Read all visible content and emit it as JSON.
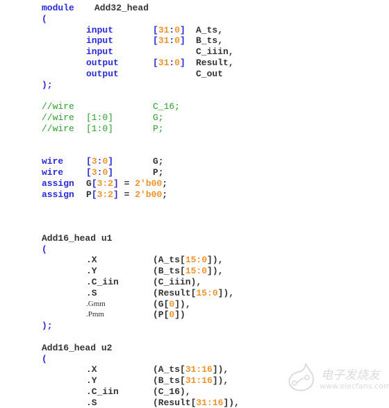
{
  "lines": [
    {
      "type": "module",
      "kw": "module",
      "name": "Add32_head"
    },
    {
      "type": "paren",
      "text": "("
    },
    {
      "type": "port",
      "kw": "input",
      "range_l": "[",
      "range_n": "31",
      "range_c": ":",
      "range_m": "0",
      "range_r": "]",
      "name": "A_ts,"
    },
    {
      "type": "port",
      "kw": "input",
      "range_l": "[",
      "range_n": "31",
      "range_c": ":",
      "range_m": "0",
      "range_r": "]",
      "name": "B_ts,"
    },
    {
      "type": "port",
      "kw": "input",
      "name": "C_iiin,"
    },
    {
      "type": "port",
      "kw": "output",
      "range_l": "[",
      "range_n": "31",
      "range_c": ":",
      "range_m": "0",
      "range_r": "]",
      "name": "Result,"
    },
    {
      "type": "port",
      "kw": "output",
      "name": "C_out"
    },
    {
      "type": "paren",
      "text": ");"
    },
    {
      "type": "blank"
    },
    {
      "type": "comment",
      "c1": "//wire",
      "c2": "",
      "c3": "C_16;"
    },
    {
      "type": "comment",
      "c1": "//wire",
      "c2": "[1:0]",
      "c3": "G;"
    },
    {
      "type": "comment",
      "c1": "//wire",
      "c2": "[1:0]",
      "c3": "P;"
    },
    {
      "type": "blank"
    },
    {
      "type": "blank"
    },
    {
      "type": "wire",
      "kw": "wire",
      "range_l": "[",
      "range_n": "3",
      "range_c": ":",
      "range_m": "0",
      "range_r": "]",
      "name": "G;"
    },
    {
      "type": "wire",
      "kw": "wire",
      "range_l": "[",
      "range_n": "3",
      "range_c": ":",
      "range_m": "0",
      "range_r": "]",
      "name": "P;"
    },
    {
      "type": "assign",
      "kw": "assign",
      "lhs": "G",
      "idx_l": "[",
      "idx": "3:2",
      "idx_r": "]",
      "eq": " = ",
      "val": "2'b00",
      "end": ";"
    },
    {
      "type": "assign",
      "kw": "assign",
      "lhs": "P",
      "idx_l": "[",
      "idx": "3:2",
      "idx_r": "]",
      "eq": " = ",
      "val": "2'b00",
      "end": ";"
    },
    {
      "type": "blank"
    },
    {
      "type": "blank"
    },
    {
      "type": "blank"
    },
    {
      "type": "inst",
      "text": "Add16_head u1"
    },
    {
      "type": "paren",
      "text": "("
    },
    {
      "type": "conn",
      "port": ".X",
      "pre": "(A_ts[",
      "num": "15:0",
      "post": "]),"
    },
    {
      "type": "conn",
      "port": ".Y",
      "pre": "(B_ts[",
      "num": "15:0",
      "post": "]),"
    },
    {
      "type": "conn",
      "port": ".C_iin",
      "pre": "(C_iiin),",
      "num": "",
      "post": ""
    },
    {
      "type": "conn",
      "port": ".S",
      "pre": "(Result[",
      "num": "15:0",
      "post": "]),"
    },
    {
      "type": "conn",
      "port": ".Gmm",
      "small": true,
      "pre": "(G[",
      "num": "0",
      "post": "]),"
    },
    {
      "type": "conn",
      "port": ".Pmm",
      "small": true,
      "pre": "(P[",
      "num": "0",
      "post": "])"
    },
    {
      "type": "paren",
      "text": ");"
    },
    {
      "type": "blank"
    },
    {
      "type": "inst",
      "text": "Add16_head u2"
    },
    {
      "type": "paren",
      "text": "("
    },
    {
      "type": "conn",
      "port": ".X",
      "pre": "(A_ts[",
      "num": "31:16",
      "post": "]),"
    },
    {
      "type": "conn",
      "port": ".Y",
      "pre": "(B_ts[",
      "num": "31:16",
      "post": "]),"
    },
    {
      "type": "conn",
      "port": ".C_iin",
      "pre": "(C_16),",
      "num": "",
      "post": ""
    },
    {
      "type": "conn",
      "port": ".S",
      "pre": "(Result[",
      "num": "31:16",
      "post": "]),"
    }
  ],
  "watermark": {
    "icon": "elecfans-logo-icon",
    "title": "电子发烧友",
    "url": "www.elecfans.com"
  }
}
